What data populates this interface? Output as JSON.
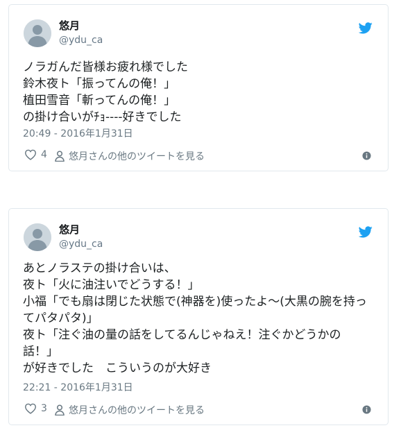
{
  "tweets": [
    {
      "name": "悠月",
      "handle": "@ydu_ca",
      "text": "ノラガんだ皆様お疲れ様でした\n鈴木夜ト「振ってんの俺！」\n植田雪音「斬ってんの俺！」\nの掛け合いがﾁｮ----好きでした",
      "timestamp": "20:49 - 2016年1月31日",
      "likes": "4",
      "more_link": "悠月さんの他のツイートを見る"
    },
    {
      "name": "悠月",
      "handle": "@ydu_ca",
      "text": "あとノラステの掛け合いは、\n夜ト「火に油注いでどうする！」\n小福「でも扇は閉じた状態で(神器を)使ったよ〜(大黒の腕を持ってパタパタ)」\n夜ト「注ぐ油の量の話をしてるんじゃねえ！注ぐかどうかの話！」\nが好きでした　こういうのが大好き",
      "timestamp": "22:21 - 2016年1月31日",
      "likes": "3",
      "more_link": "悠月さんの他のツイートを見る"
    }
  ],
  "colors": {
    "brand": "#1da1f2",
    "muted": "#697882",
    "border": "#e1e8ed",
    "text": "#1c2022"
  },
  "icons": {
    "bird": "twitter-bird-icon",
    "heart": "heart-icon",
    "person": "person-icon",
    "info": "info-icon"
  }
}
